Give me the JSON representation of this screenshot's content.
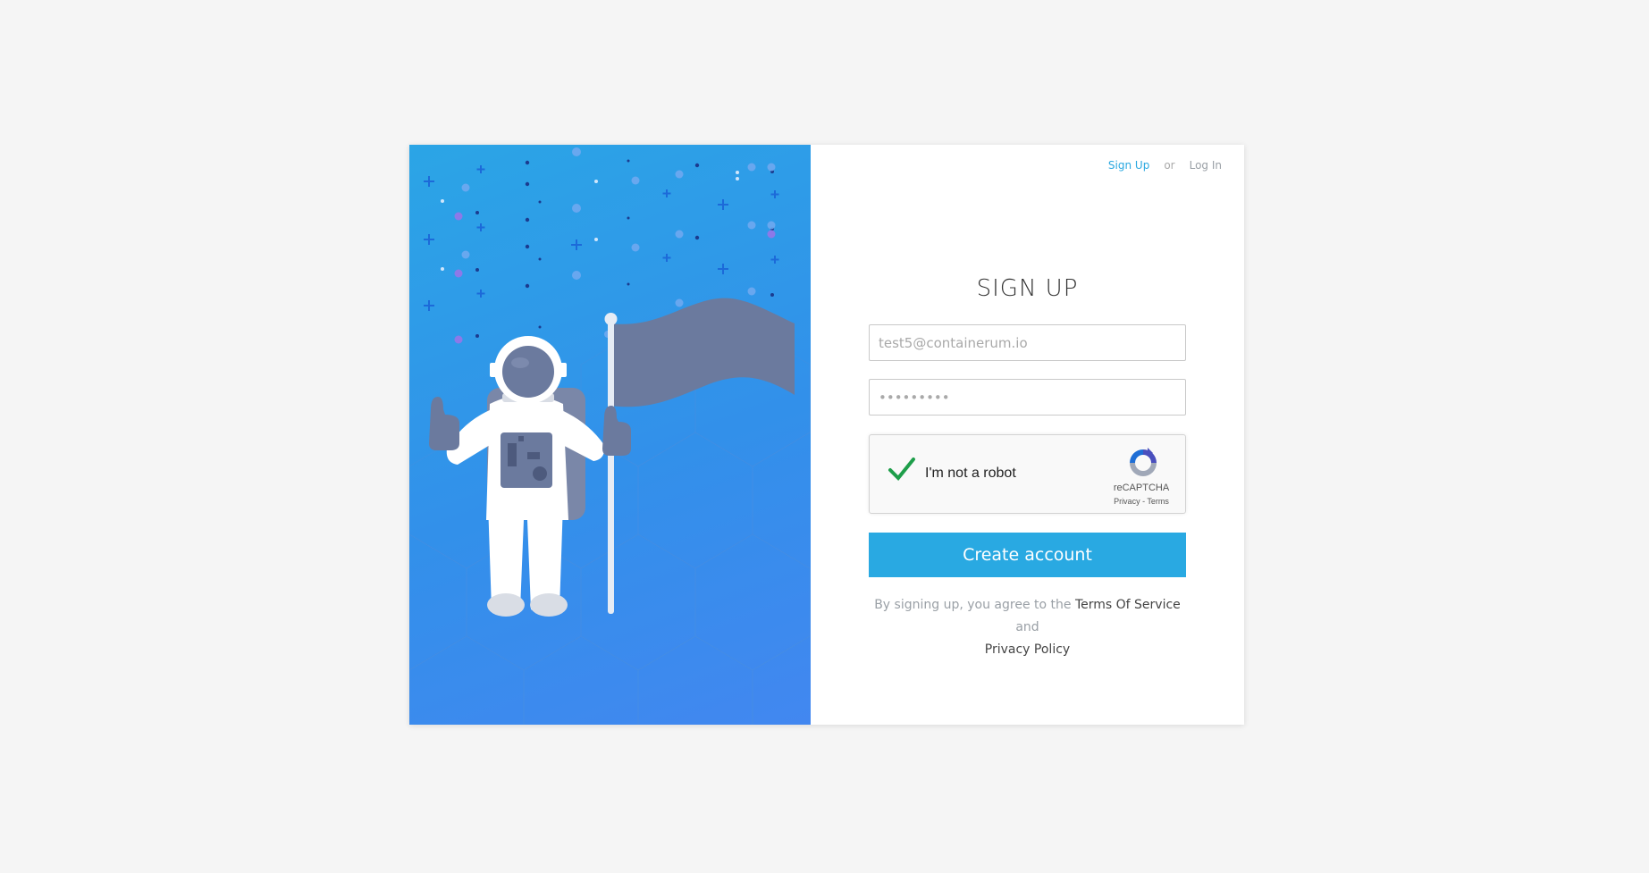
{
  "colors": {
    "page_bg": "#f5f5f5",
    "hero_gradient_start": "#2ba5e6",
    "hero_gradient_end": "#4287f0",
    "accent": "#29a9e2",
    "recaptcha_check": "#1e9e4a",
    "flag": "#6b7a9e"
  },
  "nav": {
    "signup_label": "Sign Up",
    "separator": "or",
    "login_label": "Log In"
  },
  "form": {
    "title": "SIGN UP",
    "email_value": "test5@containerum.io",
    "password_value": "•••••••••",
    "submit_label": "Create account"
  },
  "captcha": {
    "label": "I'm not a robot",
    "brand": "reCAPTCHA",
    "privacy": "Privacy",
    "dash": " - ",
    "terms": "Terms",
    "checked": true
  },
  "terms": {
    "prefix": "By signing up, you agree to the ",
    "tos_link": "Terms Of Service",
    "middle": " and ",
    "privacy_link": "Privacy Policy"
  },
  "illustration": {
    "icons": [
      "astronaut-illustration",
      "flag-illustration",
      "stars-decoration"
    ]
  }
}
